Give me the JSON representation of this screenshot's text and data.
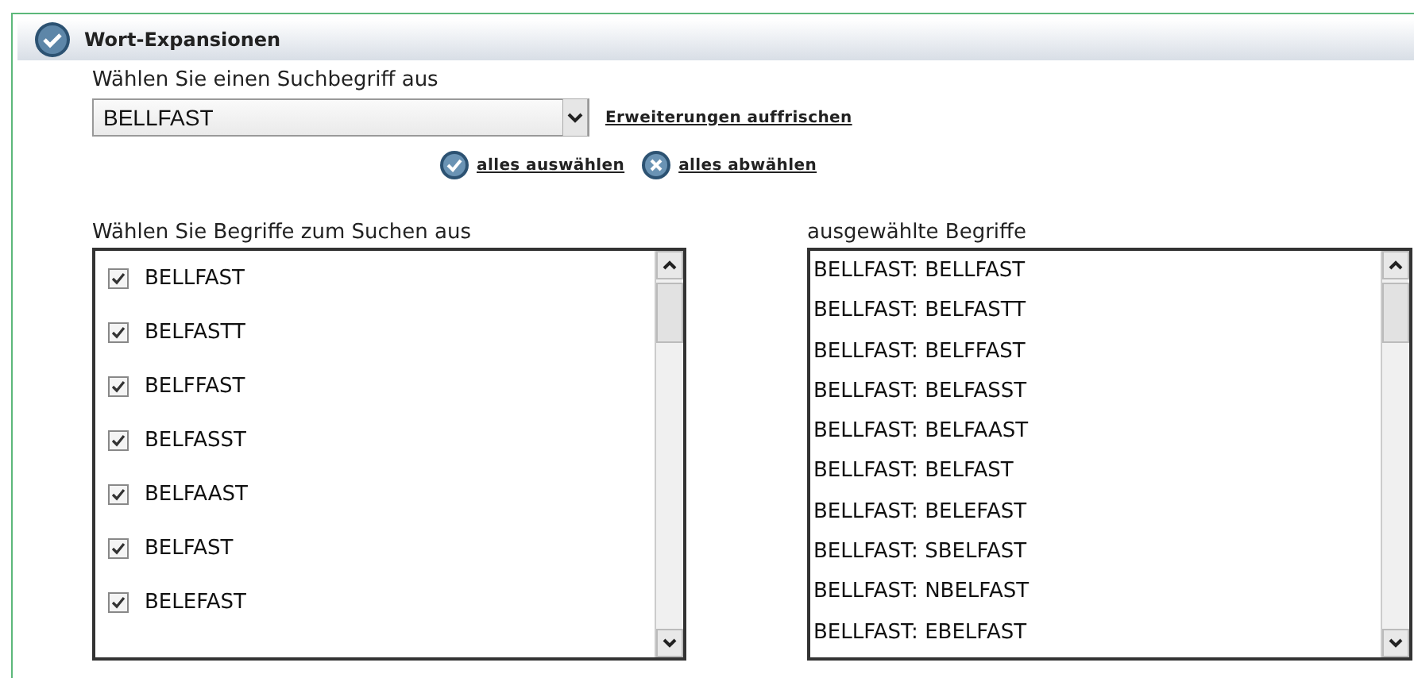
{
  "panel": {
    "title": "Wort-Expansionen"
  },
  "search_term": {
    "label": "Wählen Sie einen Suchbegriff aus",
    "value": "BELLFAST",
    "refresh_link": "Erweiterungen auffrischen"
  },
  "actions": [
    {
      "kind": "select",
      "label": "alles auswählen"
    },
    {
      "kind": "deselect",
      "label": "alles abwählen"
    }
  ],
  "terms": {
    "label": "Wählen Sie Begriffe zum Suchen aus",
    "items": [
      {
        "label": "BELLFAST",
        "checked": true
      },
      {
        "label": "BELFASTT",
        "checked": true
      },
      {
        "label": "BELFFAST",
        "checked": true
      },
      {
        "label": "BELFASST",
        "checked": true
      },
      {
        "label": "BELFAAST",
        "checked": true
      },
      {
        "label": "BELFAST",
        "checked": true
      },
      {
        "label": "BELEFAST",
        "checked": true
      }
    ]
  },
  "selected_terms": {
    "label": "ausgewählte Begriffe",
    "items": [
      "BELLFAST: BELLFAST",
      "BELLFAST: BELFASTT",
      "BELLFAST: BELFFAST",
      "BELLFAST: BELFASST",
      "BELLFAST: BELFAAST",
      "BELLFAST: BELFAST",
      "BELLFAST: BELEFAST",
      "BELLFAST: SBELFAST",
      "BELLFAST: NBELFAST",
      "BELLFAST: EBELFAST"
    ]
  }
}
